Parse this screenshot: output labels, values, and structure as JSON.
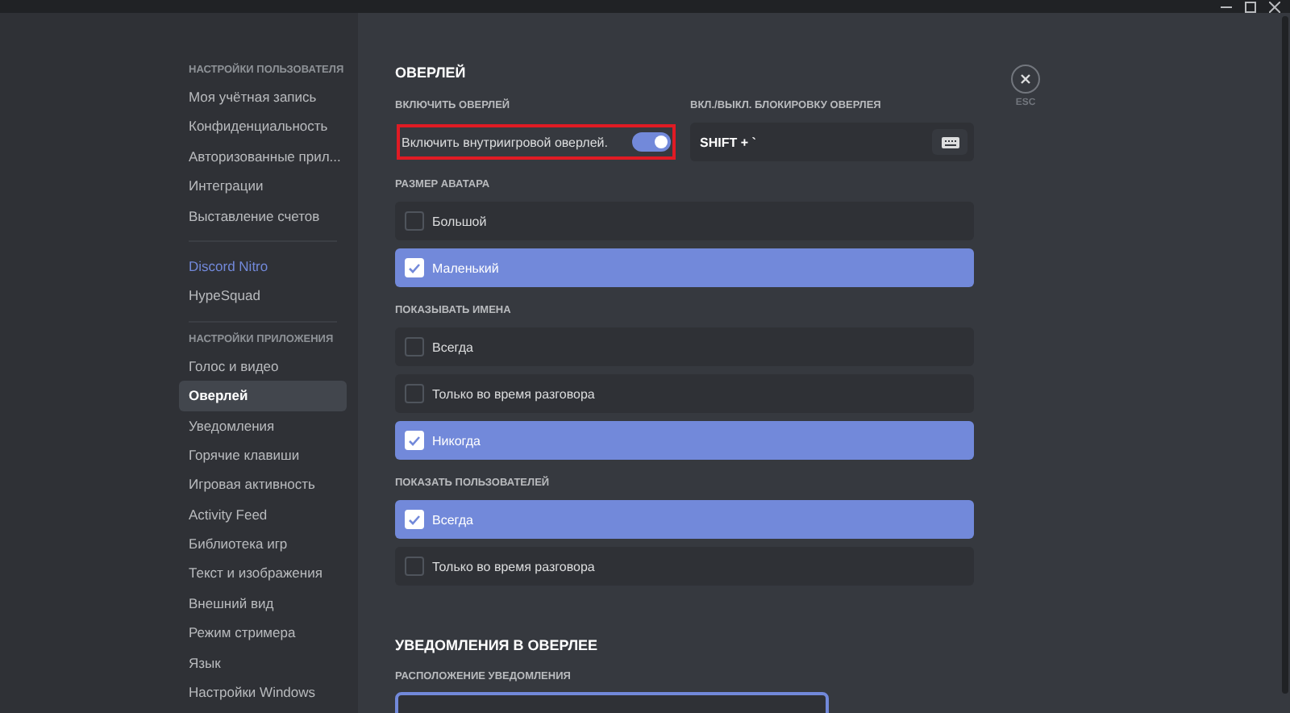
{
  "sidebar": {
    "groups": [
      {
        "header": "НАСТРОЙКИ ПОЛЬЗОВАТЕЛЯ",
        "items": [
          {
            "label": "Моя учётная запись",
            "selected": false
          },
          {
            "label": "Конфиденциальность",
            "selected": false
          },
          {
            "label": "Авторизованные прил...",
            "selected": false
          },
          {
            "label": "Интеграции",
            "selected": false
          },
          {
            "label": "Выставление счетов",
            "selected": false
          }
        ]
      },
      {
        "items": [
          {
            "label": "Discord Nitro",
            "selected": false,
            "kind": "accent"
          },
          {
            "label": "HypeSquad",
            "selected": false
          }
        ]
      },
      {
        "header": "НАСТРОЙКИ ПРИЛОЖЕНИЯ",
        "items": [
          {
            "label": "Голос и видео",
            "selected": false
          },
          {
            "label": "Оверлей",
            "selected": true
          },
          {
            "label": "Уведомления",
            "selected": false
          },
          {
            "label": "Горячие клавиши",
            "selected": false
          },
          {
            "label": "Игровая активность",
            "selected": false
          },
          {
            "label": "Activity Feed",
            "selected": false
          },
          {
            "label": "Библиотека игр",
            "selected": false
          },
          {
            "label": "Текст и изображения",
            "selected": false
          },
          {
            "label": "Внешний вид",
            "selected": false
          },
          {
            "label": "Режим стримера",
            "selected": false
          },
          {
            "label": "Язык",
            "selected": false
          },
          {
            "label": "Настройки Windows",
            "selected": false
          }
        ]
      }
    ]
  },
  "content": {
    "title": "ОВЕРЛЕЙ",
    "enable": {
      "label": "ВКЛЮЧИТЬ ОВЕРЛЕЙ",
      "text": "Включить внутриигровой оверлей.",
      "on": true,
      "highlighted": true
    },
    "keybind": {
      "label": "ВКЛ./ВЫКЛ. БЛОКИРОВКУ ОВЕРЛЕЯ",
      "value": "SHIFT + `"
    },
    "sections": [
      {
        "label": "РАЗМЕР АВАТАРА",
        "options": [
          {
            "label": "Большой",
            "checked": false
          },
          {
            "label": "Маленький",
            "checked": true
          }
        ]
      },
      {
        "label": "ПОКАЗЫВАТЬ ИМЕНА",
        "options": [
          {
            "label": "Всегда",
            "checked": false
          },
          {
            "label": "Только во время разговора",
            "checked": false
          },
          {
            "label": "Никогда",
            "checked": true
          }
        ]
      },
      {
        "label": "ПОКАЗАТЬ ПОЛЬЗОВАТЕЛЕЙ",
        "options": [
          {
            "label": "Всегда",
            "checked": true
          },
          {
            "label": "Только во время разговора",
            "checked": false
          }
        ]
      }
    ],
    "notifications": {
      "title": "УВЕДОМЛЕНИЯ В ОВЕРЛЕЕ",
      "label": "РАСПОЛОЖЕНИЕ УВЕДОМЛЕНИЯ"
    },
    "close": {
      "label": "ESC"
    }
  }
}
